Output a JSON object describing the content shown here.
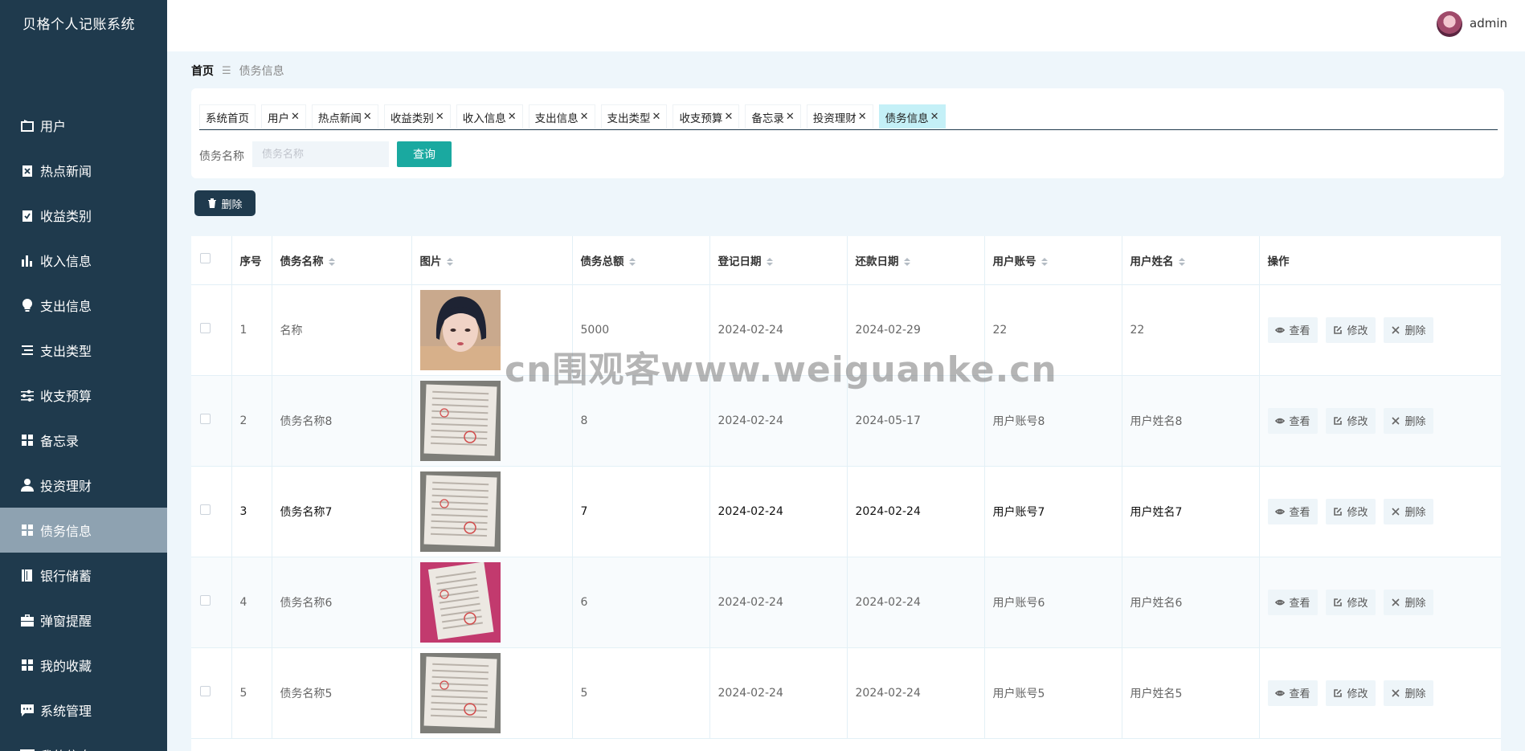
{
  "app": {
    "title": "贝格个人记账系统"
  },
  "header": {
    "username": "admin"
  },
  "sidebar": {
    "items": [
      {
        "label": "用户",
        "icon": "user-card-icon"
      },
      {
        "label": "热点新闻",
        "icon": "clipboard-x-icon"
      },
      {
        "label": "收益类别",
        "icon": "clipboard-check-icon"
      },
      {
        "label": "收入信息",
        "icon": "bar-chart-icon"
      },
      {
        "label": "支出信息",
        "icon": "lightbulb-icon"
      },
      {
        "label": "支出类型",
        "icon": "list-icon"
      },
      {
        "label": "收支预算",
        "icon": "sliders-icon"
      },
      {
        "label": "备忘录",
        "icon": "grid-icon"
      },
      {
        "label": "投资理财",
        "icon": "person-icon"
      },
      {
        "label": "债务信息",
        "icon": "grid-icon",
        "active": true
      },
      {
        "label": "银行储蓄",
        "icon": "book-icon"
      },
      {
        "label": "弹窗提醒",
        "icon": "briefcase-icon"
      },
      {
        "label": "我的收藏",
        "icon": "grid-icon"
      },
      {
        "label": "系统管理",
        "icon": "chat-icon"
      },
      {
        "label": "我的信息",
        "icon": "id-card-icon"
      }
    ]
  },
  "breadcrumb": {
    "home": "首页",
    "separator": "☰",
    "current": "债务信息"
  },
  "tabs": [
    {
      "label": "系统首页",
      "closable": false
    },
    {
      "label": "用户",
      "closable": true
    },
    {
      "label": "热点新闻",
      "closable": true
    },
    {
      "label": "收益类别",
      "closable": true
    },
    {
      "label": "收入信息",
      "closable": true
    },
    {
      "label": "支出信息",
      "closable": true
    },
    {
      "label": "支出类型",
      "closable": true
    },
    {
      "label": "收支预算",
      "closable": true
    },
    {
      "label": "备忘录",
      "closable": true
    },
    {
      "label": "投资理财",
      "closable": true
    },
    {
      "label": "债务信息",
      "closable": true,
      "active": true
    }
  ],
  "tab_close_glyph": "✕",
  "search": {
    "label": "债务名称",
    "placeholder": "债务名称",
    "value": "",
    "button": "查询"
  },
  "toolbar": {
    "delete_label": "删除"
  },
  "table": {
    "headers": [
      "序号",
      "债务名称",
      "图片",
      "债务总额",
      "登记日期",
      "还款日期",
      "用户账号",
      "用户姓名",
      "操作"
    ],
    "actions": {
      "view": "查看",
      "edit": "修改",
      "delete": "删除"
    },
    "rows": [
      {
        "index": "1",
        "name": "名称",
        "amount": "5000",
        "reg_date": "2024-02-24",
        "repay_date": "2024-02-29",
        "account": "22",
        "user_name": "22",
        "image": "portrait"
      },
      {
        "index": "2",
        "name": "债务名称8",
        "amount": "8",
        "reg_date": "2024-02-24",
        "repay_date": "2024-05-17",
        "account": "用户账号8",
        "user_name": "用户姓名8",
        "image": "document"
      },
      {
        "index": "3",
        "name": "债务名称7",
        "amount": "7",
        "reg_date": "2024-02-24",
        "repay_date": "2024-02-24",
        "account": "用户账号7",
        "user_name": "用户姓名7",
        "image": "document"
      },
      {
        "index": "4",
        "name": "债务名称6",
        "amount": "6",
        "reg_date": "2024-02-24",
        "repay_date": "2024-02-24",
        "account": "用户账号6",
        "user_name": "用户姓名6",
        "image": "document-red"
      },
      {
        "index": "5",
        "name": "债务名称5",
        "amount": "5",
        "reg_date": "2024-02-24",
        "repay_date": "2024-02-24",
        "account": "用户账号5",
        "user_name": "用户姓名5",
        "image": "document"
      }
    ]
  },
  "watermark": "cn围观客www.weiguanke.cn"
}
